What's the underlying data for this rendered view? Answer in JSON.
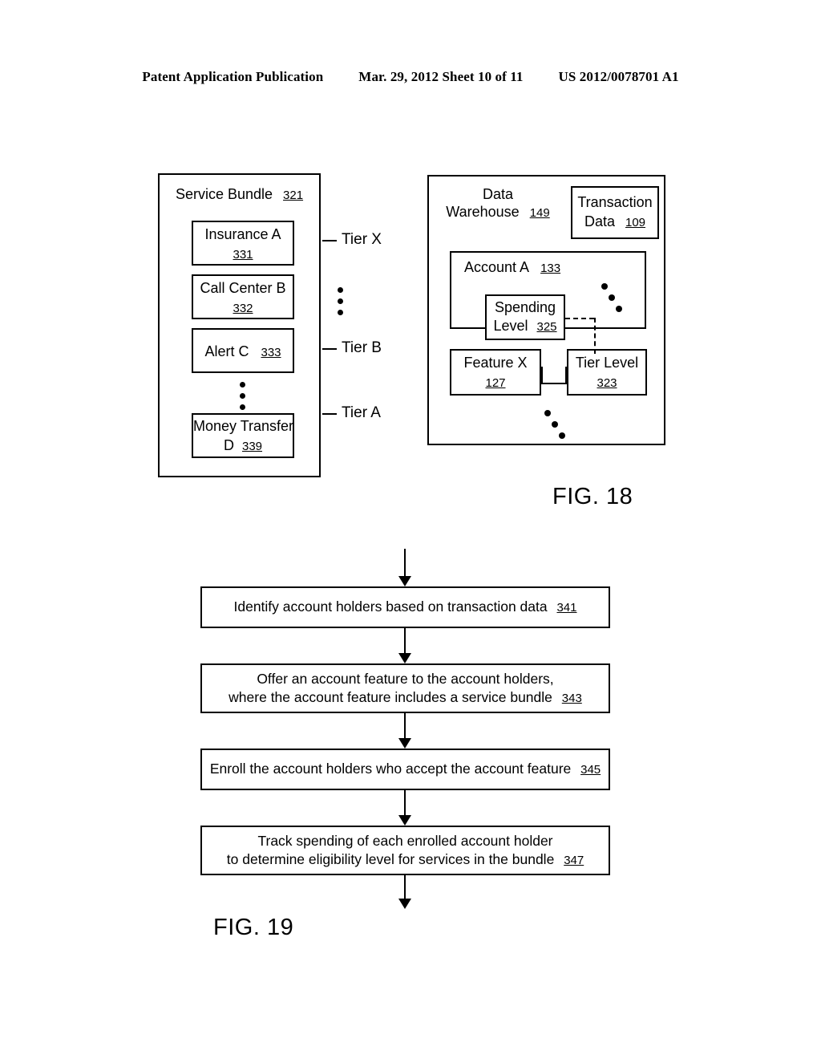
{
  "header": {
    "publication": "Patent Application Publication",
    "date_sheet": "Mar. 29, 2012  Sheet 10 of 11",
    "pub_number": "US 2012/0078701 A1"
  },
  "fig18": {
    "caption": "FIG. 18",
    "service_bundle": {
      "title": "Service Bundle",
      "ref": "321",
      "items": [
        {
          "label": "Insurance A",
          "ref": "331"
        },
        {
          "label": "Call Center B",
          "ref": "332"
        },
        {
          "label": "Alert C",
          "ref": "333"
        },
        {
          "label": "Money Transfer D",
          "ref": "339"
        }
      ],
      "tiers": [
        {
          "label": "Tier X"
        },
        {
          "label": "Tier B"
        },
        {
          "label": "Tier A"
        }
      ]
    },
    "data_warehouse": {
      "title_line1": "Data",
      "title_line2": "Warehouse",
      "ref": "149",
      "transaction_data": {
        "line1": "Transaction",
        "line2": "Data",
        "ref": "109"
      },
      "account": {
        "label": "Account A",
        "ref": "133",
        "spending_level": {
          "line1": "Spending",
          "line2": "Level",
          "ref": "325"
        },
        "feature": {
          "label": "Feature X",
          "ref": "127"
        },
        "tier_level": {
          "line1": "Tier Level",
          "ref": "323"
        }
      }
    }
  },
  "fig19": {
    "caption": "FIG. 19",
    "steps": [
      {
        "line1": "Identify account holders based on transaction data",
        "line2": "",
        "ref": "341"
      },
      {
        "line1": "Offer an account feature to the account holders,",
        "line2": "where the account feature includes a service bundle",
        "ref": "343"
      },
      {
        "line1": "Enroll the account holders who accept the account feature",
        "line2": "",
        "ref": "345"
      },
      {
        "line1": "Track spending of each enrolled account holder",
        "line2": "to determine eligibility level for services in the bundle",
        "ref": "347"
      }
    ]
  }
}
